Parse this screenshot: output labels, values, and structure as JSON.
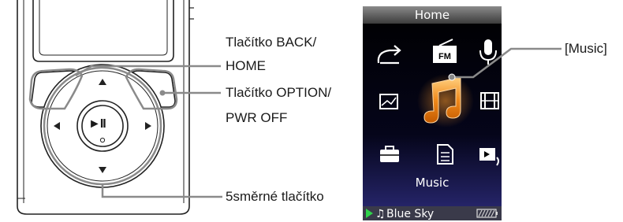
{
  "device_labels": {
    "back_home_line1": "Tlačítko BACK/",
    "back_home_line2": "HOME",
    "option_line1": "Tlačítko OPTION/",
    "option_line2": "PWR OFF",
    "five_way": "5směrné tlačítko",
    "music_callout": "[Music]"
  },
  "screen": {
    "title": "Home",
    "selected_label": "Music",
    "now_playing_prefix": "► ♫",
    "now_playing_title": "Blue Sky",
    "play_indicator_color": "#2fd24a",
    "selected_icon_color": "#f08a1c",
    "icons": [
      {
        "row": 0,
        "col": 0,
        "name": "shuffle-all-icon"
      },
      {
        "row": 0,
        "col": 1,
        "name": "fm-radio-icon",
        "text": "FM"
      },
      {
        "row": 0,
        "col": 2,
        "name": "voice-recording-icon"
      },
      {
        "row": 1,
        "col": 0,
        "name": "photo-icon"
      },
      {
        "row": 1,
        "col": 1,
        "name": "music-icon"
      },
      {
        "row": 1,
        "col": 2,
        "name": "video-icon"
      },
      {
        "row": 2,
        "col": 0,
        "name": "settings-icon"
      },
      {
        "row": 2,
        "col": 1,
        "name": "podcast-icon"
      },
      {
        "row": 2,
        "col": 2,
        "name": "now-playing-icon"
      }
    ]
  },
  "device_buttons": {
    "play_pause_glyph": "►II"
  }
}
